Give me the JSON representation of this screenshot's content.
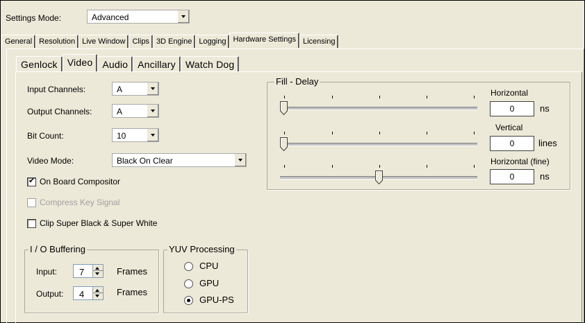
{
  "settings_mode": {
    "label": "Settings Mode:",
    "value": "Advanced"
  },
  "main_tabs": [
    {
      "label": "General",
      "active": false
    },
    {
      "label": "Resolution",
      "active": false
    },
    {
      "label": "Live Window",
      "active": false
    },
    {
      "label": "Clips",
      "active": false
    },
    {
      "label": "3D Engine",
      "active": false
    },
    {
      "label": "Logging",
      "active": false
    },
    {
      "label": "Hardware Settings",
      "active": true
    },
    {
      "label": "Licensing",
      "active": false
    }
  ],
  "sub_tabs": [
    {
      "label": "Genlock",
      "active": false
    },
    {
      "label": "Video",
      "active": true
    },
    {
      "label": "Audio",
      "active": false
    },
    {
      "label": "Ancillary",
      "active": false
    },
    {
      "label": "Watch Dog",
      "active": false
    }
  ],
  "video": {
    "input_channels": {
      "label": "Input Channels:",
      "value": "A"
    },
    "output_channels": {
      "label": "Output Channels:",
      "value": "A"
    },
    "bit_count": {
      "label": "Bit Count:",
      "value": "10"
    },
    "video_mode": {
      "label": "Video Mode:",
      "value": "Black On Clear"
    },
    "on_board_compositor": {
      "label": "On Board Compositor",
      "checked": true,
      "mark": "✔"
    },
    "compress_key_signal": {
      "label": "Compress Key Signal",
      "checked": false,
      "enabled": false
    },
    "clip_super": {
      "label": "Clip Super Black & Super White",
      "checked": false
    }
  },
  "io_buffering": {
    "title": "I / O Buffering",
    "input": {
      "label": "Input:",
      "value": "7",
      "unit": "Frames"
    },
    "output": {
      "label": "Output:",
      "value": "4",
      "unit": "Frames"
    }
  },
  "yuv_processing": {
    "title": "YUV Processing",
    "options": [
      {
        "label": "CPU",
        "selected": false
      },
      {
        "label": "GPU",
        "selected": false
      },
      {
        "label": "GPU-PS",
        "selected": true
      }
    ]
  },
  "fill_delay": {
    "title": "Fill - Delay",
    "horizontal": {
      "label": "Horizontal",
      "value": "0",
      "unit": "ns",
      "slider_fraction": 0.0
    },
    "vertical": {
      "label": "Vertical",
      "value": "0",
      "unit": "lines",
      "slider_fraction": 0.0
    },
    "horizontal_fine": {
      "label": "Horizontal (fine)",
      "value": "0",
      "unit": "ns",
      "slider_fraction": 0.5
    }
  }
}
